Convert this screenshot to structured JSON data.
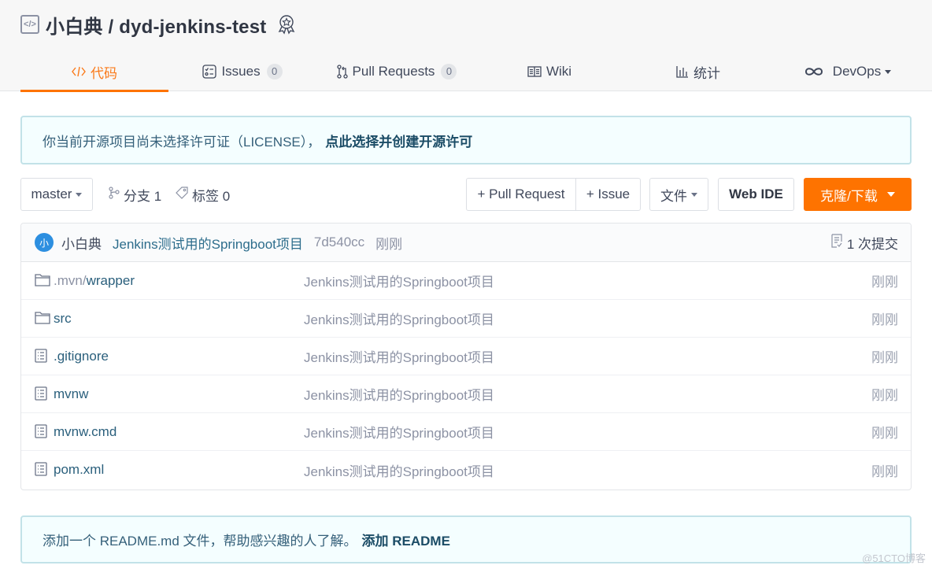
{
  "header": {
    "owner": "小白典",
    "repo": "dyd-jenkins-test",
    "title": "小白典 / dyd-jenkins-test",
    "repo_icon": "code-repo-icon",
    "badge_icon": "award-badge-icon"
  },
  "tabs": [
    {
      "label": "代码",
      "icon": "code-icon",
      "active": true
    },
    {
      "label": "Issues",
      "icon": "issues-icon",
      "count": "0"
    },
    {
      "label": "Pull Requests",
      "icon": "pull-request-icon",
      "count": "0"
    },
    {
      "label": "Wiki",
      "icon": "book-icon"
    },
    {
      "label": "统计",
      "icon": "bar-chart-icon"
    },
    {
      "label": "DevOps",
      "icon": "infinity-icon",
      "dropdown": true
    }
  ],
  "license_notice": {
    "text": "你当前开源项目尚未选择许可证（LICENSE），",
    "link": "点此选择并创建开源许可"
  },
  "toolbar": {
    "branch": "master",
    "branches_label": "分支 1",
    "tags_label": "标签 0",
    "new_pr": "+ Pull Request",
    "new_issue": "+ Issue",
    "file_menu": "文件",
    "web_ide": "Web IDE",
    "clone": "克隆/下载"
  },
  "last_commit": {
    "avatar": "小",
    "author": "小白典",
    "message": "Jenkins测试用的Springboot项目",
    "sha": "7d540cc",
    "time": "刚刚",
    "commit_count": "1 次提交"
  },
  "files": [
    {
      "type": "folder",
      "name_prefix": ".mvn/",
      "name": "wrapper",
      "message": "Jenkins测试用的Springboot项目",
      "time": "刚刚"
    },
    {
      "type": "folder",
      "name_prefix": "",
      "name": "src",
      "message": "Jenkins测试用的Springboot项目",
      "time": "刚刚"
    },
    {
      "type": "file",
      "name_prefix": "",
      "name": ".gitignore",
      "message": "Jenkins测试用的Springboot项目",
      "time": "刚刚"
    },
    {
      "type": "file",
      "name_prefix": "",
      "name": "mvnw",
      "message": "Jenkins测试用的Springboot项目",
      "time": "刚刚"
    },
    {
      "type": "file",
      "name_prefix": "",
      "name": "mvnw.cmd",
      "message": "Jenkins测试用的Springboot项目",
      "time": "刚刚"
    },
    {
      "type": "file",
      "name_prefix": "",
      "name": "pom.xml",
      "message": "Jenkins测试用的Springboot项目",
      "time": "刚刚"
    }
  ],
  "readme_notice": {
    "text": "添加一个 README.md 文件，帮助感兴趣的人了解。",
    "link": "添加 README"
  },
  "watermark": "@51CTO博客",
  "colors": {
    "accent": "#fe7300",
    "link": "#2a5f7c",
    "avatar": "#2d8fe0"
  }
}
